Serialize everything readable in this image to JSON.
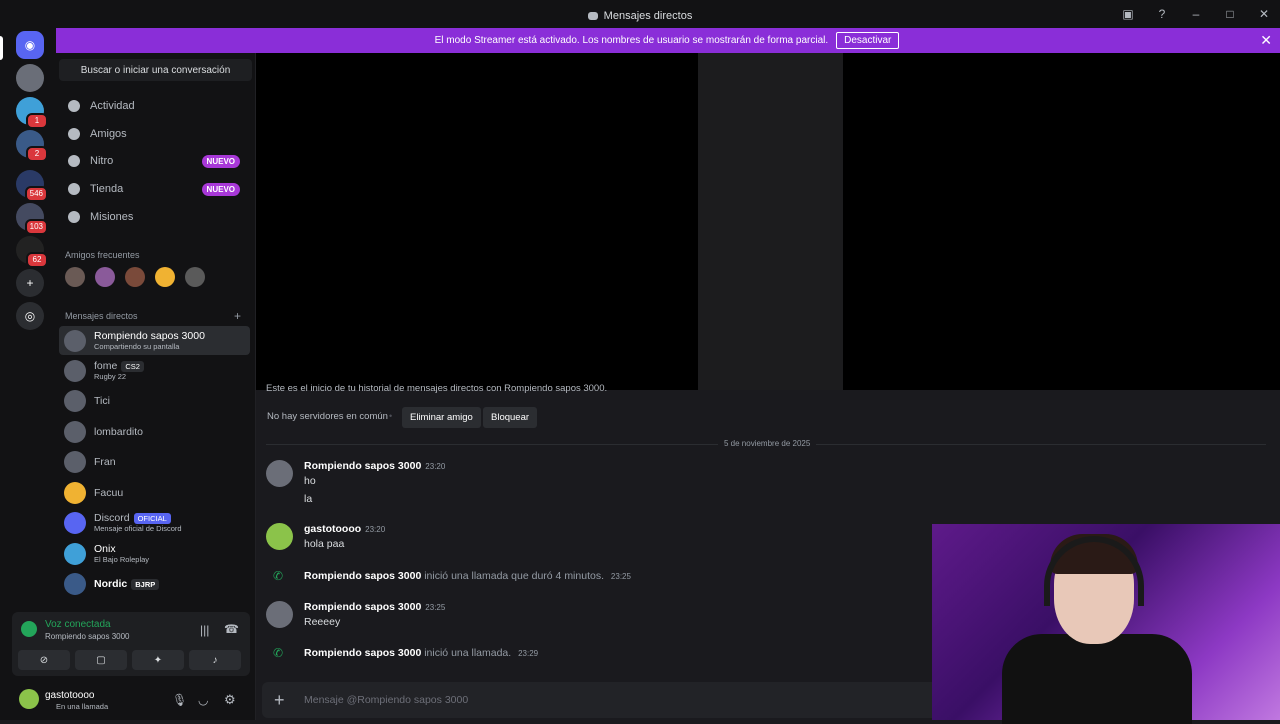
{
  "window": {
    "title": "Mensajes directos"
  },
  "banner": {
    "text": "El modo Streamer está activado. Los nombres de usuario se mostrarán de forma parcial.",
    "button": "Desactivar"
  },
  "guilds": [
    {
      "badge": ""
    },
    {
      "badge": "1"
    },
    {
      "badge": "2"
    },
    {
      "badge": "546"
    },
    {
      "badge": "103"
    },
    {
      "badge": "62"
    }
  ],
  "sidebar": {
    "search": "Buscar o iniciar una conversación",
    "nav": [
      "Actividad",
      "Amigos",
      "Nitro",
      "Tienda",
      "Misiones"
    ],
    "nuevo": "NUEVO",
    "frequent_header": "Amigos frecuentes",
    "dm_header": "Mensajes directos",
    "dms": [
      {
        "name": "Rompiendo sapos 3000",
        "sub": "Compartiendo su pantalla"
      },
      {
        "name": "fome",
        "tag": "CS2",
        "sub": "Rugby 22"
      },
      {
        "name": "Tici",
        "sub": ""
      },
      {
        "name": "lombardito",
        "sub": ""
      },
      {
        "name": "Fran",
        "sub": ""
      },
      {
        "name": "Facuu",
        "sub": ""
      },
      {
        "name": "Discord",
        "tag": "OFICIAL",
        "sub": "Mensaje oficial de Discord"
      },
      {
        "name": "Onix",
        "sub": "El Bajo Roleplay"
      },
      {
        "name": "Nordic",
        "tag": "BJRP",
        "sub": ""
      }
    ]
  },
  "voice": {
    "title": "Voz conectada",
    "sub": "Rompiendo sapos 3000"
  },
  "user": {
    "name": "gastotoooo",
    "status": "En una llamada"
  },
  "chat": {
    "history_intro": "Este es el inicio de tu historial de mensajes directos con Rompiendo sapos 3000.",
    "no_servers": "No hay servidores en común",
    "remove_friend": "Eliminar amigo",
    "block": "Bloquear",
    "date": "5 de noviembre de 2025",
    "messages": [
      {
        "author": "Rompiendo sapos 3000",
        "time": "23:20",
        "lines": [
          "ho",
          "la"
        ]
      },
      {
        "author": "gastotoooo",
        "time": "23:20",
        "lines": [
          "hola paa"
        ]
      },
      {
        "author": "Rompiendo sapos 3000",
        "time": "23:25",
        "lines": [
          "Reeeey"
        ]
      }
    ],
    "system": [
      {
        "author": "Rompiendo sapos 3000",
        "text": "inició una llamada que duró 4 minutos.",
        "time": "23:25"
      },
      {
        "author": "Rompiendo sapos 3000",
        "text": "inició una llamada.",
        "time": "23:29"
      }
    ],
    "composer_placeholder": "Mensaje @Rompiendo sapos 3000"
  }
}
